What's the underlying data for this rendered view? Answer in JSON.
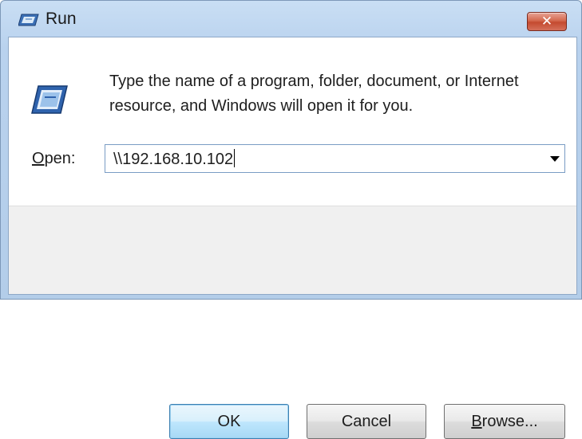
{
  "window": {
    "title": "Run",
    "close_label": "✕"
  },
  "dialog": {
    "description": "Type the name of a program, folder, document, or Internet resource, and Windows will open it for you.",
    "open_label_mnemonic": "O",
    "open_label_rest": "pen:",
    "open_value": "\\\\192.168.10.102"
  },
  "buttons": {
    "ok": "OK",
    "cancel": "Cancel",
    "browse_mnemonic": "B",
    "browse_rest": "rowse..."
  },
  "icons": {
    "title": "run-icon",
    "main": "run-icon",
    "dropdown": "chevron-down-icon"
  },
  "colors": {
    "titlebar": "#b9d2ee",
    "close": "#c44a2f",
    "default_button_border": "#3c7fb1"
  }
}
